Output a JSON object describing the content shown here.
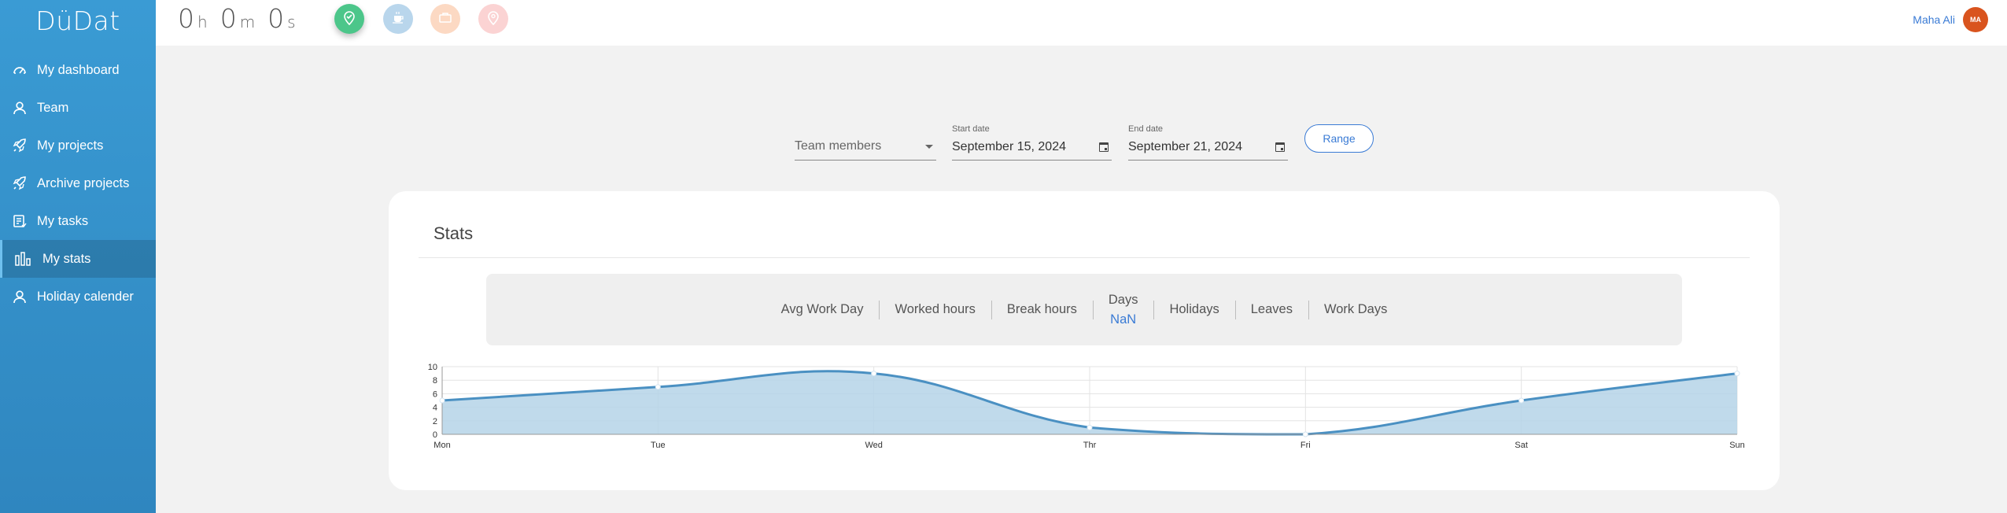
{
  "app": {
    "logo": "DüDat"
  },
  "sidebar": {
    "items": [
      {
        "label": "My dashboard",
        "icon": "speedometer-icon",
        "active": false
      },
      {
        "label": "Team",
        "icon": "person-icon",
        "active": false
      },
      {
        "label": "My projects",
        "icon": "rocket-icon",
        "active": false
      },
      {
        "label": "Archive projects",
        "icon": "rocket-icon",
        "active": false
      },
      {
        "label": "My tasks",
        "icon": "task-list-icon",
        "active": false
      },
      {
        "label": "My stats",
        "icon": "bar-chart-icon",
        "active": true
      },
      {
        "label": "Holiday calender",
        "icon": "person-icon",
        "active": false
      }
    ]
  },
  "timer": {
    "hours": "0",
    "hours_unit": "h",
    "minutes": "0",
    "minutes_unit": "m",
    "seconds": "0",
    "seconds_unit": "s"
  },
  "status_buttons": [
    {
      "icon": "location-check-icon",
      "color": "#4cc68a"
    },
    {
      "icon": "coffee-cup-icon",
      "color": "#b9d6ec"
    },
    {
      "icon": "briefcase-icon",
      "color": "#fcd9c3"
    },
    {
      "icon": "location-pin-icon",
      "color": "#fbd3d3"
    }
  ],
  "user": {
    "name": "Maha Ali",
    "initials": "MA",
    "avatar_color": "#d9541e"
  },
  "filters": {
    "team_members": {
      "placeholder": "Team members"
    },
    "start_date": {
      "label": "Start date",
      "value": "September 15, 2024"
    },
    "end_date": {
      "label": "End date",
      "value": "September 21, 2024"
    },
    "range_button": "Range"
  },
  "stats": {
    "title": "Stats",
    "tabs": [
      {
        "label": "Avg Work Day"
      },
      {
        "label": "Worked hours"
      },
      {
        "label": "Break hours"
      },
      {
        "label": "Days",
        "value": "NaN"
      },
      {
        "label": "Holidays"
      },
      {
        "label": "Leaves"
      },
      {
        "label": "Work Days"
      }
    ]
  },
  "chart_data": {
    "type": "area",
    "categories": [
      "Mon",
      "Tue",
      "Wed",
      "Thr",
      "Fri",
      "Sat",
      "Sun"
    ],
    "series": [
      {
        "values": [
          5,
          7,
          9,
          1,
          0,
          5,
          9
        ]
      }
    ],
    "yticks": [
      0,
      2,
      4,
      6,
      8,
      10
    ],
    "ylim": [
      0,
      10
    ],
    "grid": true,
    "line_color": "#4a90c2",
    "fill_color": "#b5d3e7"
  }
}
